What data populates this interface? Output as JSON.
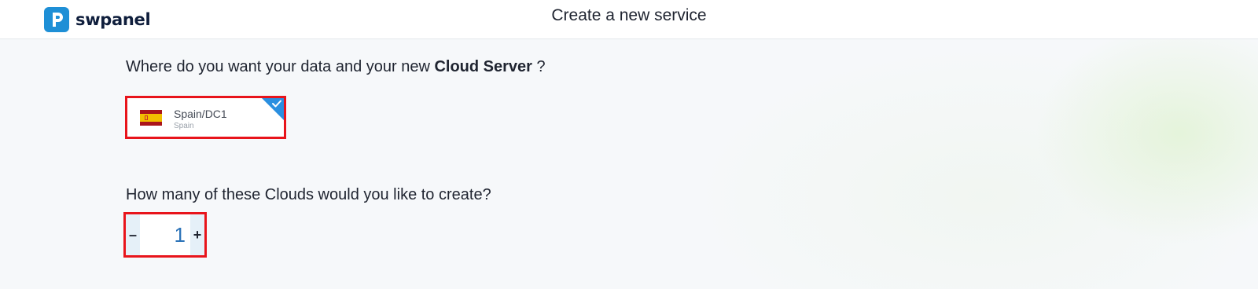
{
  "header": {
    "brand": "swpanel",
    "title": "Create a new service"
  },
  "location": {
    "question_prefix": "Where do you want your data and your new",
    "question_bold": "Cloud Server",
    "question_suffix": "?",
    "selected_datacenter": {
      "name": "Spain/DC1",
      "country": "Spain",
      "flag": "spain-flag-icon"
    }
  },
  "quantity": {
    "question": "How many of these Clouds would you like to create?",
    "decrement_label": "–",
    "value": "1",
    "increment_label": "+"
  },
  "colors": {
    "accent": "#1e8fd6",
    "highlight_border": "#e8141b",
    "check_badge": "#2a8fe0",
    "value_text": "#2b73b8"
  }
}
